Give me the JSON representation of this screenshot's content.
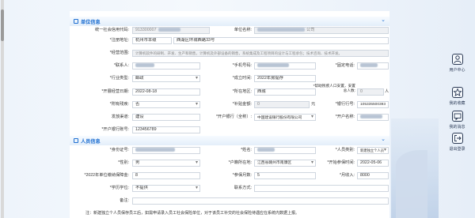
{
  "unit_section": {
    "title": "单位信息"
  },
  "unit": {
    "credit_code_label": "统一社会信用代码:",
    "credit_code_value": "913300007",
    "name_label": "单位名称:",
    "name_value": "公司",
    "address_label": "*注册地址:",
    "province_value": "杭州市本级",
    "address_value": "西湖区环城西路33号",
    "scope_label": "*经营范围:",
    "scope_value": "计算机软件的研制、开发、生产和销售，计算机及外部设备的销售，系统集成及工程项目的设计与工程承包；技术咨询、技术开发。",
    "contact_label": "*联系人:",
    "mobile_label": "*手机号码:",
    "fixed_phone_label": "*固定电话:",
    "industry_label": "*行业类型:",
    "industry_value": "邮政",
    "establish_label": "*成立时间:",
    "establish_value": "2022年房提存",
    "form_date_label": "*开展经营日期:",
    "form_date_value": "2022-08-18",
    "location_label": "*所在地区:",
    "location_value": "西城",
    "employees_label": "*帮助残疾人口安置，安置总人数:",
    "employees_value": "0",
    "employees_unit": "人",
    "ratio_label": "*附有残疾:",
    "ratio_value": "否",
    "subsidy_label": "*补贴金额:",
    "subsidy_value": "0",
    "subsidy_unit": "元",
    "bank_code_label": "*银行行号:",
    "bank_code_value": "105335500393",
    "pay_label": "发放渠道:",
    "pay_value": "建设",
    "bank_label": "*开户银行（全称）:",
    "bank_value": "中国建设银行股份有限公司",
    "account_name_label": "*开户名称:",
    "account_label": "*开户银行账号:",
    "account_value": "123456789"
  },
  "person_section": {
    "title": "人员信息"
  },
  "person": {
    "id_label": "*身份证号:",
    "name_label": "*姓名:",
    "type_label": "*人员类别:",
    "type_value": "新建独立个人员",
    "gender_label": "*性别:",
    "gender_value": "男",
    "household_label": "*户籍所在地:",
    "household_value": "江西省赣州市南康区",
    "start_label": "*开始参保时间:",
    "start_value": "2022-05-06",
    "insure_label": "*2022年单位缴纳保障金:",
    "insure_value": "8",
    "months_label": "*参保月数:",
    "months_value": "5",
    "salary_label": "*月收入:",
    "salary_value": "8000",
    "degree_label": "*学历学位:",
    "degree_value": "不提供",
    "contact_label": "联系方式:",
    "remark_label": "备注:",
    "note": "注：新建独立个人员保存员工后，如需申请录入员工社会保险单位，对于该员工补交的社会保险待遇应在系统内数据上报。"
  },
  "sidebar": {
    "items": [
      {
        "label": "用户中心",
        "icon": "user-icon"
      },
      {
        "label": "我的收藏",
        "icon": "star-icon"
      },
      {
        "label": "我的消息",
        "icon": "message-icon"
      },
      {
        "label": "退出登录",
        "icon": "logout-icon"
      }
    ]
  },
  "colors": {
    "accent": "#1f6fd1",
    "section_bg": "#e3eefa"
  }
}
